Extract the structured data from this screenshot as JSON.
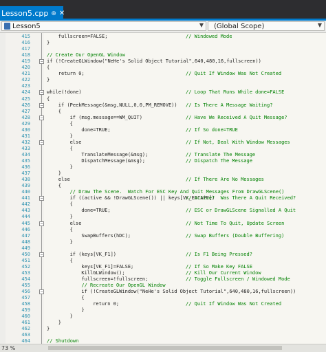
{
  "tab": {
    "title": "Lesson5.cpp",
    "pin_icon": "pin-icon",
    "close_glyph": "✕"
  },
  "navbar": {
    "file_combo": "Lesson5",
    "scope_combo": "(Global Scope)"
  },
  "status": {
    "zoom": "73 %"
  },
  "lines": [
    {
      "n": "415",
      "code": "fullscreen=FALSE;",
      "indent": 4,
      "comment": "// Windowed Mode"
    },
    {
      "n": "416",
      "code": "}",
      "indent": 0,
      "comment": ""
    },
    {
      "n": "417",
      "code": "",
      "indent": 0,
      "comment": ""
    },
    {
      "n": "418",
      "code": "// Create Our OpenGL Window",
      "indent": 0,
      "comment": "",
      "is_comment": true
    },
    {
      "n": "419",
      "code": "if (!CreateGLWindow(\"NeHe's Solid Object Tutorial\",640,480,16,fullscreen))",
      "indent": 0,
      "comment": ""
    },
    {
      "n": "420",
      "code": "{",
      "indent": 0,
      "comment": ""
    },
    {
      "n": "421",
      "code": "return 0;",
      "indent": 4,
      "comment": "// Quit If Window Was Not Created"
    },
    {
      "n": "422",
      "code": "}",
      "indent": 0,
      "comment": ""
    },
    {
      "n": "423",
      "code": "",
      "indent": 0,
      "comment": ""
    },
    {
      "n": "424",
      "code": "while(!done)",
      "indent": 0,
      "comment": "// Loop That Runs While done=FALSE"
    },
    {
      "n": "425",
      "code": "{",
      "indent": 0,
      "comment": ""
    },
    {
      "n": "426",
      "code": "if (PeekMessage(&msg,NULL,0,0,PM_REMOVE))",
      "indent": 4,
      "comment": "// Is There A Message Waiting?"
    },
    {
      "n": "427",
      "code": "{",
      "indent": 4,
      "comment": ""
    },
    {
      "n": "428",
      "code": "if (msg.message==WM_QUIT)",
      "indent": 8,
      "comment": "// Have We Received A Quit Message?"
    },
    {
      "n": "429",
      "code": "{",
      "indent": 8,
      "comment": ""
    },
    {
      "n": "430",
      "code": "done=TRUE;",
      "indent": 12,
      "comment": "// If So done=TRUE"
    },
    {
      "n": "431",
      "code": "}",
      "indent": 8,
      "comment": ""
    },
    {
      "n": "432",
      "code": "else",
      "indent": 8,
      "comment": "// If Not, Deal With Window Messages"
    },
    {
      "n": "433",
      "code": "{",
      "indent": 8,
      "comment": ""
    },
    {
      "n": "434",
      "code": "TranslateMessage(&msg);",
      "indent": 12,
      "comment": "// Translate The Message"
    },
    {
      "n": "435",
      "code": "DispatchMessage(&msg);",
      "indent": 12,
      "comment": "// Dispatch The Message"
    },
    {
      "n": "436",
      "code": "}",
      "indent": 8,
      "comment": ""
    },
    {
      "n": "437",
      "code": "}",
      "indent": 4,
      "comment": ""
    },
    {
      "n": "438",
      "code": "else",
      "indent": 4,
      "comment": "// If There Are No Messages"
    },
    {
      "n": "439",
      "code": "{",
      "indent": 4,
      "comment": ""
    },
    {
      "n": "440",
      "code": "// Draw The Scene.  Watch For ESC Key And Quit Messages From DrawGLScene()",
      "indent": 8,
      "comment": "",
      "is_comment": true
    },
    {
      "n": "441",
      "code": "if ((active && !DrawGLScene()) || keys[VK_ESCAPE])",
      "indent": 8,
      "comment": "// Active?  Was There A Quit Received?"
    },
    {
      "n": "442",
      "code": "{",
      "indent": 8,
      "comment": ""
    },
    {
      "n": "443",
      "code": "done=TRUE;",
      "indent": 12,
      "comment": "// ESC or DrawGLScene Signalled A Quit"
    },
    {
      "n": "444",
      "code": "}",
      "indent": 8,
      "comment": ""
    },
    {
      "n": "445",
      "code": "else",
      "indent": 8,
      "comment": "// Not Time To Quit, Update Screen"
    },
    {
      "n": "446",
      "code": "{",
      "indent": 8,
      "comment": ""
    },
    {
      "n": "447",
      "code": "SwapBuffers(hDC);",
      "indent": 12,
      "comment": "// Swap Buffers (Double Buffering)"
    },
    {
      "n": "448",
      "code": "}",
      "indent": 8,
      "comment": ""
    },
    {
      "n": "449",
      "code": "",
      "indent": 0,
      "comment": ""
    },
    {
      "n": "450",
      "code": "if (keys[VK_F1])",
      "indent": 8,
      "comment": "// Is F1 Being Pressed?"
    },
    {
      "n": "451",
      "code": "{",
      "indent": 8,
      "comment": ""
    },
    {
      "n": "452",
      "code": "keys[VK_F1]=FALSE;",
      "indent": 12,
      "comment": "// If So Make Key FALSE"
    },
    {
      "n": "453",
      "code": "KillGLWindow();",
      "indent": 12,
      "comment": "// Kill Our Current Window"
    },
    {
      "n": "454",
      "code": "fullscreen=!fullscreen;",
      "indent": 12,
      "comment": "// Toggle Fullscreen / Windowed Mode"
    },
    {
      "n": "455",
      "code": "// Recreate Our OpenGL Window",
      "indent": 12,
      "comment": "",
      "is_comment": true
    },
    {
      "n": "456",
      "code": "if (!CreateGLWindow(\"NeHe's Solid Object Tutorial\",640,480,16,fullscreen))",
      "indent": 12,
      "comment": ""
    },
    {
      "n": "457",
      "code": "{",
      "indent": 12,
      "comment": ""
    },
    {
      "n": "458",
      "code": "return 0;",
      "indent": 16,
      "comment": "// Quit If Window Was Not Created"
    },
    {
      "n": "459",
      "code": "}",
      "indent": 12,
      "comment": ""
    },
    {
      "n": "460",
      "code": "}",
      "indent": 8,
      "comment": ""
    },
    {
      "n": "461",
      "code": "}",
      "indent": 4,
      "comment": ""
    },
    {
      "n": "462",
      "code": "}",
      "indent": 0,
      "comment": ""
    },
    {
      "n": "463",
      "code": "",
      "indent": 0,
      "comment": ""
    },
    {
      "n": "464",
      "code": "// Shutdown",
      "indent": 0,
      "comment": "",
      "is_comment": true
    }
  ],
  "folds": [
    "419",
    "424",
    "426",
    "428",
    "432",
    "441",
    "445",
    "450",
    "456"
  ]
}
